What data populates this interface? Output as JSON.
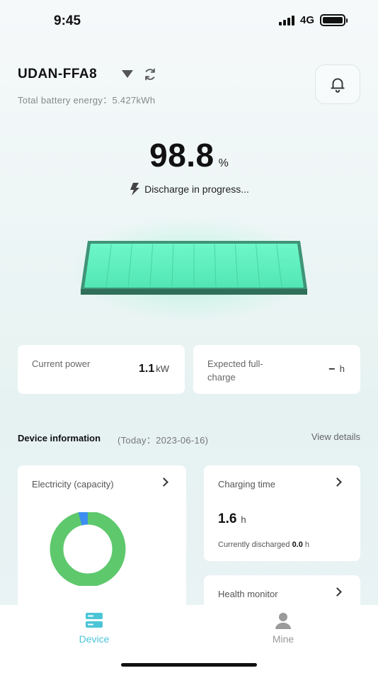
{
  "status": {
    "time": "9:45",
    "network": "4G"
  },
  "header": {
    "device_name": "UDAN-FFA8",
    "energy_label": "Total battery energy：5.427kWh"
  },
  "battery": {
    "percent": "98.8",
    "percent_unit": "%",
    "state": "Discharge in progress...",
    "level": 0.988,
    "colors": {
      "fill": "#5ff0c0",
      "frame": "#3a8a6e"
    }
  },
  "stats": {
    "power_label": "Current power",
    "power_value": "1.1",
    "power_unit": "kW",
    "full_label": "Expected full-charge",
    "full_value": "–",
    "full_unit": "h"
  },
  "device_info": {
    "title": "Device information",
    "date": "(Today：2023-06-16)",
    "view_details": "View details",
    "electricity": {
      "title": "Electricity (capacity)",
      "used_fraction": 0.04,
      "colors": {
        "main": "#5ec86d",
        "used": "#3d8ef0"
      }
    },
    "charging": {
      "title": "Charging time",
      "value": "1.6",
      "unit": "h",
      "discharged_label": "Currently discharged",
      "discharged_value": "0.0",
      "discharged_unit": "h"
    },
    "health": {
      "title": "Health monitor"
    }
  },
  "tabs": [
    {
      "label": "Device",
      "icon": "device-icon",
      "active": true
    },
    {
      "label": "Mine",
      "icon": "person-icon",
      "active": false
    }
  ],
  "colors": {
    "accent": "#4cc5d6"
  }
}
